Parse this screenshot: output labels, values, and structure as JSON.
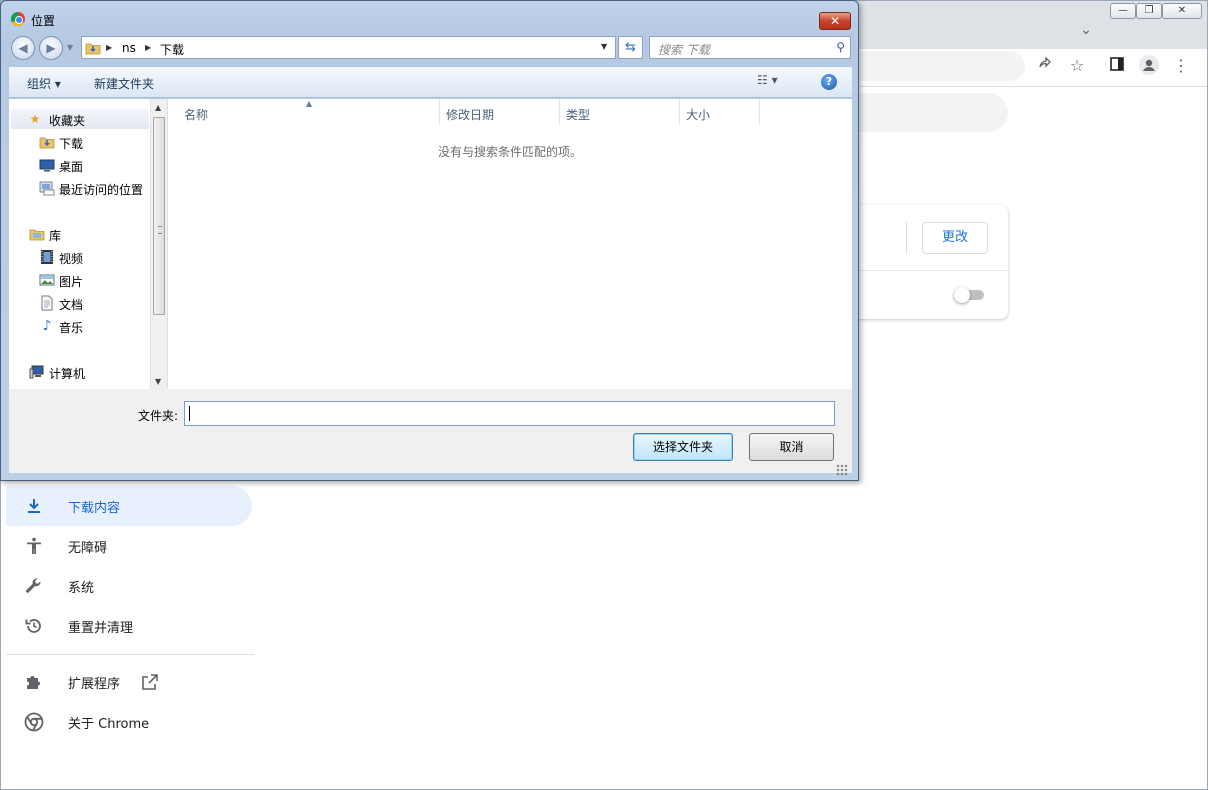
{
  "chrome": {
    "settings": {
      "change_label": "更改"
    },
    "sidebar": {
      "items": [
        {
          "label": "下载内容",
          "icon": "download-icon",
          "active": true
        },
        {
          "label": "无障碍",
          "icon": "accessibility-icon"
        },
        {
          "label": "系统",
          "icon": "wrench-icon"
        },
        {
          "label": "重置并清理",
          "icon": "restore-icon"
        },
        {
          "label": "扩展程序",
          "icon": "extension-icon"
        },
        {
          "label": "关于 Chrome",
          "icon": "chrome-icon"
        }
      ]
    },
    "accent_color": "#1a73e8"
  },
  "dialog": {
    "title": "位置",
    "close_label": "✕",
    "path": [
      "ns",
      "下载"
    ],
    "search_placeholder": "搜索 下载",
    "commands": {
      "organize": "组织 ▾",
      "new_folder": "新建文件夹"
    },
    "nav": {
      "favorites": "收藏夹",
      "downloads": "下载",
      "desktop": "桌面",
      "recent": "最近访问的位置",
      "libraries": "库",
      "videos": "视频",
      "pictures": "图片",
      "documents": "文档",
      "music": "音乐",
      "computer": "计算机"
    },
    "columns": [
      "名称",
      "修改日期",
      "类型",
      "大小"
    ],
    "empty_message": "没有与搜索条件匹配的项。",
    "folder_label": "文件夹:",
    "folder_value": "",
    "select_button": "选择文件夹",
    "cancel_button": "取消"
  }
}
